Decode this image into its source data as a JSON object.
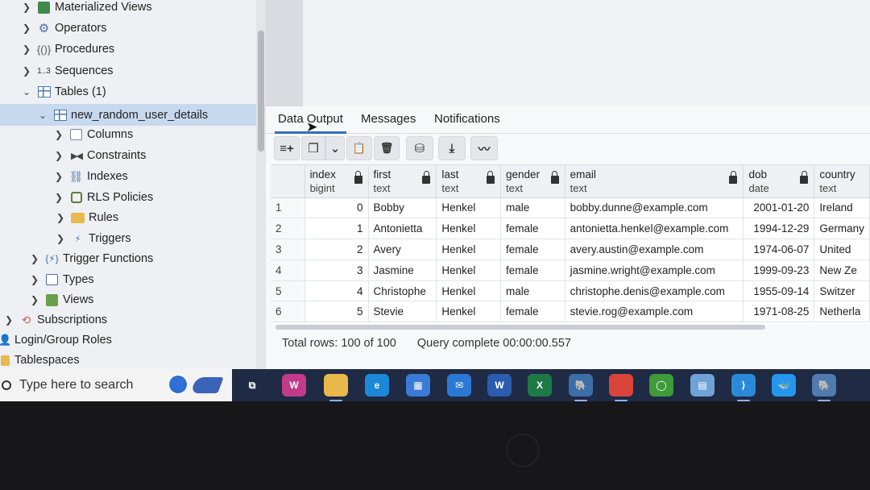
{
  "tree": {
    "items": [
      {
        "label": "Materialized Views",
        "icon": "materialized-view-icon",
        "expanded": false
      },
      {
        "label": "Operators",
        "icon": "operator-icon",
        "expanded": false
      },
      {
        "label": "Procedures",
        "icon": "procedure-icon",
        "expanded": false
      },
      {
        "label": "Sequences",
        "icon": "sequence-icon",
        "icon_text": "1..3",
        "expanded": false
      },
      {
        "label": "Tables (1)",
        "icon": "table-icon",
        "expanded": true
      },
      {
        "label": "new_random_user_details",
        "icon": "table-icon",
        "expanded": true,
        "selected": true
      },
      {
        "label": "Columns",
        "icon": "columns-icon",
        "expanded": false
      },
      {
        "label": "Constraints",
        "icon": "constraints-icon",
        "expanded": false
      },
      {
        "label": "Indexes",
        "icon": "indexes-icon",
        "expanded": false
      },
      {
        "label": "RLS Policies",
        "icon": "rls-policy-icon",
        "expanded": false
      },
      {
        "label": "Rules",
        "icon": "rules-icon",
        "expanded": false
      },
      {
        "label": "Triggers",
        "icon": "triggers-icon",
        "expanded": false
      },
      {
        "label": "Trigger Functions",
        "icon": "trigger-function-icon",
        "expanded": false
      },
      {
        "label": "Types",
        "icon": "types-icon",
        "expanded": false
      },
      {
        "label": "Views",
        "icon": "views-icon",
        "expanded": false
      },
      {
        "label": "Subscriptions",
        "icon": "subscription-icon",
        "expanded": false
      },
      {
        "label": "Login/Group Roles",
        "icon": "roles-icon"
      },
      {
        "label": "Tablespaces",
        "icon": "tablespace-icon"
      }
    ]
  },
  "tabs": [
    {
      "label": "Data Output",
      "active": true
    },
    {
      "label": "Messages",
      "active": false
    },
    {
      "label": "Notifications",
      "active": false
    }
  ],
  "toolbar": {
    "buttons": [
      {
        "name": "add-row-icon",
        "glyph": "≡+"
      },
      {
        "name": "copy-icon",
        "glyph": "❐"
      },
      {
        "name": "chevron-down-icon",
        "glyph": "⌄"
      },
      {
        "name": "paste-icon",
        "glyph": "📋"
      },
      {
        "name": "delete-icon",
        "glyph": "🗑"
      },
      {
        "name": "save-data-icon",
        "glyph": "⛁"
      },
      {
        "name": "download-icon",
        "glyph": "⤓"
      },
      {
        "name": "graph-icon",
        "glyph": "〰"
      }
    ]
  },
  "grid": {
    "columns": [
      {
        "name": "index",
        "type": "bigint"
      },
      {
        "name": "first",
        "type": "text"
      },
      {
        "name": "last",
        "type": "text"
      },
      {
        "name": "gender",
        "type": "text"
      },
      {
        "name": "email",
        "type": "text"
      },
      {
        "name": "dob",
        "type": "date"
      },
      {
        "name": "country",
        "type": "text"
      }
    ],
    "rows": [
      [
        "1",
        "0",
        "Bobby",
        "Henkel",
        "male",
        "bobby.dunne@example.com",
        "2001-01-20",
        "Ireland"
      ],
      [
        "2",
        "1",
        "Antonietta",
        "Henkel",
        "female",
        "antonietta.henkel@example.com",
        "1994-12-29",
        "Germany"
      ],
      [
        "3",
        "2",
        "Avery",
        "Henkel",
        "female",
        "avery.austin@example.com",
        "1974-06-07",
        "United"
      ],
      [
        "4",
        "3",
        "Jasmine",
        "Henkel",
        "female",
        "jasmine.wright@example.com",
        "1999-09-23",
        "New Ze"
      ],
      [
        "5",
        "4",
        "Christophe",
        "Henkel",
        "male",
        "christophe.denis@example.com",
        "1955-09-14",
        "Switzer"
      ],
      [
        "6",
        "5",
        "Stevie",
        "Henkel",
        "female",
        "stevie.rog@example.com",
        "1971-08-25",
        "Netherla"
      ]
    ]
  },
  "status": {
    "rows": "Total rows: 100 of 100",
    "query": "Query complete 00:00:00.557"
  },
  "taskbar": {
    "search_placeholder": "Type here to search",
    "apps": [
      {
        "name": "task-view-icon",
        "glyph": "⧉",
        "color": "#1f2a44"
      },
      {
        "name": "wps-office-icon",
        "glyph": "W",
        "color": "#c23b8a"
      },
      {
        "name": "file-explorer-icon",
        "glyph": "",
        "color": "#e8b84a"
      },
      {
        "name": "edge-icon",
        "glyph": "e",
        "color": "#1e88d8"
      },
      {
        "name": "store-icon",
        "glyph": "▦",
        "color": "#3a7bd5"
      },
      {
        "name": "mail-icon",
        "glyph": "✉",
        "color": "#2b79d4"
      },
      {
        "name": "word-icon",
        "glyph": "W",
        "color": "#2b5cb0"
      },
      {
        "name": "excel-icon",
        "glyph": "X",
        "color": "#1d7a45"
      },
      {
        "name": "pgadmin-icon",
        "glyph": "🐘",
        "color": "#3c6ea8"
      },
      {
        "name": "chrome-icon",
        "glyph": "",
        "color": "#d9453b"
      },
      {
        "name": "spinner-app-icon",
        "glyph": "◯",
        "color": "#3f9a3a"
      },
      {
        "name": "notepad-icon",
        "glyph": "▤",
        "color": "#6fa3d8"
      },
      {
        "name": "vscode-icon",
        "glyph": "⟩",
        "color": "#2a8ad8"
      },
      {
        "name": "docker-icon",
        "glyph": "🐳",
        "color": "#2496ed"
      },
      {
        "name": "postgres-icon",
        "glyph": "🐘",
        "color": "#4f7bb0"
      }
    ]
  }
}
